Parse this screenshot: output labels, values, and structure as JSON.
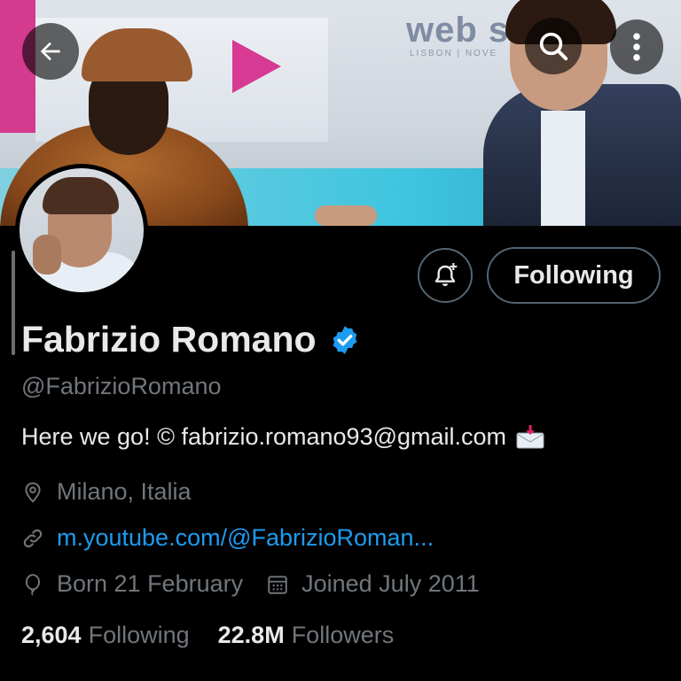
{
  "header": {
    "back_icon": "arrow-left-icon",
    "search_icon": "search-icon",
    "more_icon": "more-vertical-icon",
    "banner_text": "web s",
    "banner_subtext": "LISBON | NOVE"
  },
  "profile": {
    "name": "Fabrizio Romano",
    "handle": "@FabrizioRomano",
    "bio": "Here we go! © fabrizio.romano93@gmail.com",
    "location": "Milano, Italia",
    "link": "m.youtube.com/@FabrizioRoman...",
    "birthday": "Born 21 February",
    "joined": "Joined July 2011",
    "verified_color": "#1d9bf0"
  },
  "actions": {
    "notify_icon": "bell-plus-icon",
    "following_label": "Following"
  },
  "stats": {
    "following_count": "2,604",
    "following_label": "Following",
    "followers_count": "22.8M",
    "followers_label": "Followers"
  },
  "colors": {
    "background": "#000000",
    "text_primary": "#e7e9ea",
    "text_secondary": "#71767b",
    "link": "#1d9bf0",
    "border": "#536471"
  }
}
